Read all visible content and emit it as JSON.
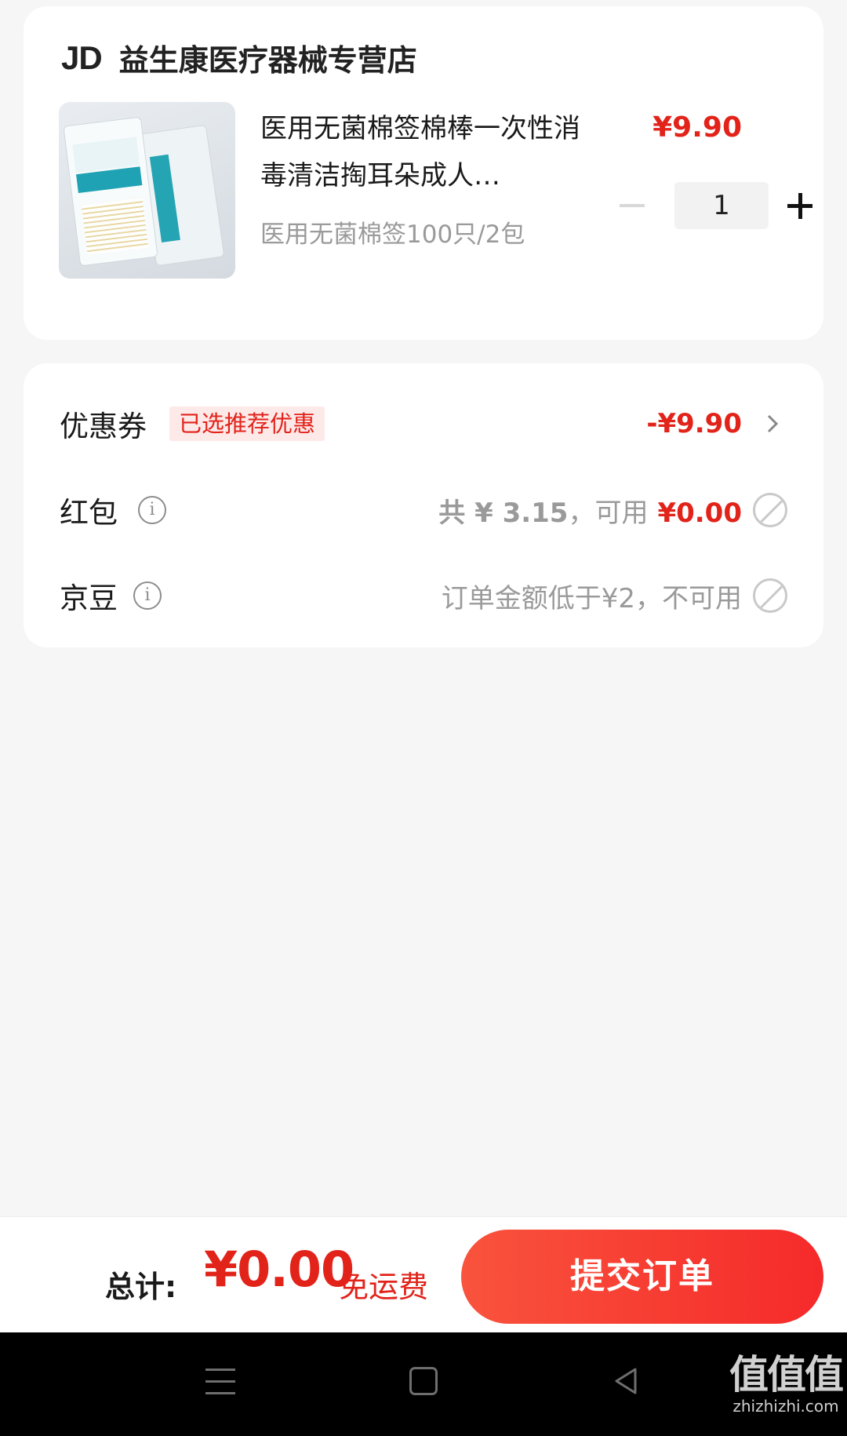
{
  "shop": {
    "logo_text": "JD",
    "name": "益生康医疗器械专营店"
  },
  "product": {
    "title": "医用无菌棉签棉棒一次性消毒清洁掏耳朵成人…",
    "spec": "医用无菌棉签100只/2包",
    "price": "¥9.90",
    "quantity": "1",
    "image_icon": "cotton-swab-package-image"
  },
  "discounts": {
    "coupon": {
      "label": "优惠券",
      "tag": "已选推荐优惠",
      "value": "-¥9.90"
    },
    "red_packet": {
      "label": "红包",
      "total_text": "共 ¥ 3.15",
      "separator": "，可用",
      "available": "¥0.00"
    },
    "jd_beans": {
      "label": "京豆",
      "status": "订单金额低于¥2，不可用"
    }
  },
  "footer": {
    "total_label": "总计:",
    "total_amount": "¥0.00",
    "shipping": "免运费",
    "submit_label": "提交订单"
  },
  "watermark": {
    "main": "值值值",
    "sub": "zhizhizhi.com"
  },
  "colors": {
    "accent_red": "#e2231a",
    "background": "#f6f6f6",
    "tag_bg": "#fde9e8"
  }
}
